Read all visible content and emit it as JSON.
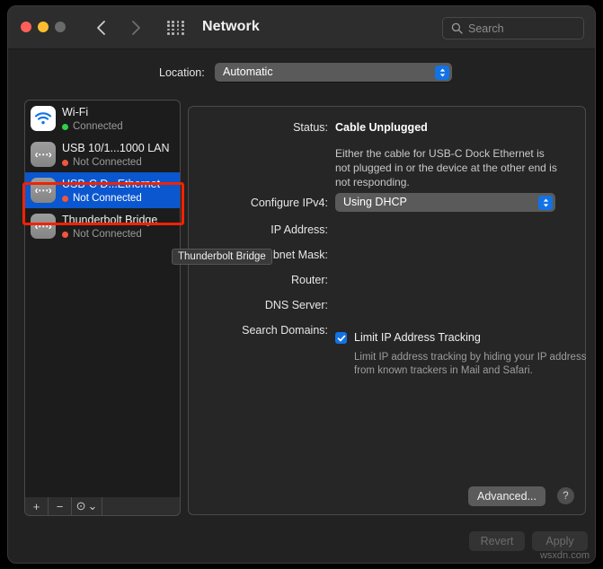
{
  "window": {
    "title": "Network"
  },
  "titlebar": {
    "close_label": "close",
    "minimize_label": "minimize",
    "zoom_label": "zoom",
    "back_label": "Back",
    "forward_label": "Forward",
    "grid_label": "Show All"
  },
  "search": {
    "placeholder": "Search",
    "value": ""
  },
  "location": {
    "label": "Location:",
    "selected": "Automatic"
  },
  "sidebar": {
    "services": [
      {
        "name": "Wi-Fi",
        "status": "Connected",
        "status_color": "#30cf4b",
        "icon": "wifi-icon",
        "selected": false
      },
      {
        "name": "USB 10/1...1000 LAN",
        "status": "Not Connected",
        "status_color": "#f3553c",
        "icon": "ethernet-icon",
        "selected": false
      },
      {
        "name": "USB-C D...Ethernet",
        "status": "Not Connected",
        "status_color": "#f3553c",
        "icon": "ethernet-icon",
        "selected": true
      },
      {
        "name": "Thunderbolt Bridge",
        "status": "Not Connected",
        "status_color": "#f3553c",
        "icon": "ethernet-icon",
        "selected": false
      }
    ],
    "toolbar": {
      "add_label": "+",
      "remove_label": "−",
      "action_label": "⊙",
      "action_chevron": "⌄"
    },
    "highlight_color": "#f32200",
    "selection_color": "#0a57d0"
  },
  "tooltip": {
    "text": "Thunderbolt Bridge"
  },
  "detail": {
    "status_label": "Status:",
    "status_value": "Cable Unplugged",
    "status_description": "Either the cable for USB-C Dock Ethernet is not plugged in or the device at the other end is not responding.",
    "configure_ipv4_label": "Configure IPv4:",
    "configure_ipv4_value": "Using DHCP",
    "ip_address_label": "IP Address:",
    "ip_address_value": "",
    "subnet_mask_label": "Subnet Mask:",
    "subnet_mask_value": "",
    "router_label": "Router:",
    "router_value": "",
    "dns_server_label": "DNS Server:",
    "dns_server_value": "",
    "search_domains_label": "Search Domains:",
    "search_domains_value": "",
    "limit_tracking_label": "Limit IP Address Tracking",
    "limit_tracking_checked": true,
    "limit_tracking_description": "Limit IP address tracking by hiding your IP address from known trackers in Mail and Safari.",
    "advanced_label": "Advanced...",
    "help_label": "?"
  },
  "footer": {
    "revert_label": "Revert",
    "apply_label": "Apply"
  },
  "watermark": {
    "text": "wsxdn.com"
  },
  "colors": {
    "accent_blue": "#1273e6",
    "selection_blue": "#0a57d0",
    "highlight_red": "#f32200",
    "status_green": "#30cf4b",
    "status_red": "#f3553c"
  }
}
